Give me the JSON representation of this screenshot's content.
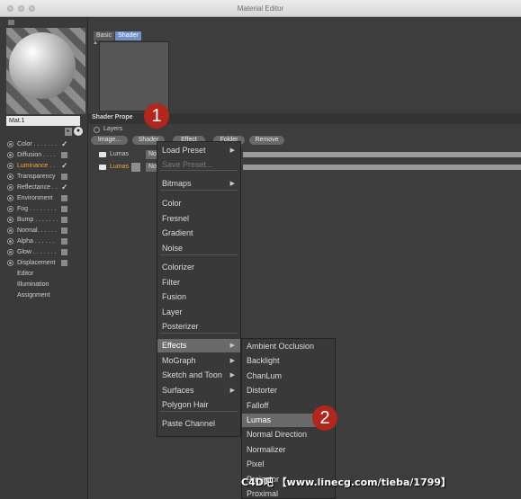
{
  "window": {
    "title": "Material Editor"
  },
  "material": {
    "name": "Mat.1"
  },
  "channels": [
    {
      "label": "Color . . . . . . .",
      "checked": true,
      "active": false
    },
    {
      "label": "Diffusion . . . .",
      "checked": false,
      "active": false
    },
    {
      "label": "Luminance . .",
      "checked": true,
      "active": true
    },
    {
      "label": "Transparency",
      "checked": false,
      "active": false
    },
    {
      "label": "Reflectance . .",
      "checked": true,
      "active": false
    },
    {
      "label": "Environment",
      "checked": false,
      "active": false
    },
    {
      "label": "Fog . . . . . . . .",
      "checked": false,
      "active": false
    },
    {
      "label": "Bump . . . . . . .",
      "checked": false,
      "active": false
    },
    {
      "label": "Normal. . . . . .",
      "checked": false,
      "active": false
    },
    {
      "label": "Alpha . . . . . .",
      "checked": false,
      "active": false
    },
    {
      "label": "Glow . . . . . . .",
      "checked": false,
      "active": false
    },
    {
      "label": "Displacement",
      "checked": false,
      "active": false
    }
  ],
  "extra_items": [
    "Editor",
    "Illumination",
    "Assignment"
  ],
  "tabs": [
    "Basic",
    "Shader"
  ],
  "shader_properties": {
    "title": "Shader Prope",
    "layers_label": "Layers",
    "buttons": [
      "Image...",
      "Shader",
      "Effect",
      "Folder",
      "Remove"
    ]
  },
  "layers": [
    {
      "name": "Lumas",
      "mode": "No",
      "active": false
    },
    {
      "name": "Lumas",
      "mode": "No",
      "active": true
    }
  ],
  "context_menu": {
    "items": [
      {
        "label": "Load Preset",
        "submenu": true
      },
      {
        "label": "Save Preset...",
        "disabled": true
      },
      {
        "label": "Bitmaps",
        "submenu": true
      },
      {
        "label": "Color"
      },
      {
        "label": "Fresnel"
      },
      {
        "label": "Gradient"
      },
      {
        "label": "Noise"
      },
      {
        "label": "Colorizer"
      },
      {
        "label": "Filter"
      },
      {
        "label": "Fusion"
      },
      {
        "label": "Layer"
      },
      {
        "label": "Posterizer"
      },
      {
        "label": "Effects",
        "submenu": true,
        "highlighted": true
      },
      {
        "label": "MoGraph",
        "submenu": true
      },
      {
        "label": "Sketch and Toon",
        "submenu": true
      },
      {
        "label": "Surfaces",
        "submenu": true
      },
      {
        "label": "Polygon Hair"
      },
      {
        "label": "Paste Channel"
      }
    ],
    "submenu_arrow": "▶"
  },
  "effects_submenu": {
    "items": [
      "Ambient Occlusion",
      "Backlight",
      "ChanLum",
      "Distorter",
      "Falloff",
      "Lumas",
      "Normal Direction",
      "Normalizer",
      "Pixel",
      "Projector",
      "Proximal"
    ],
    "highlighted_index": 5
  },
  "callouts": [
    "1",
    "2"
  ],
  "watermark": "C4D吧 【www.linecg.com/tieba/1799】",
  "icons": {
    "checkmark": "✓",
    "menu_arrow": "▶",
    "panel_arrow": "▸",
    "globe": "●"
  }
}
